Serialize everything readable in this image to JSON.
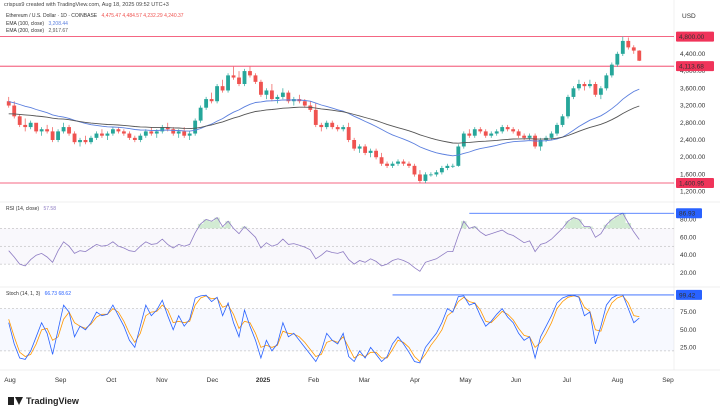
{
  "header": {
    "credit": "crispus9 created with TradingView.com, Aug 18, 2025 09:52 UTC+3"
  },
  "legend": {
    "symbol": "Ethereum / U.S. Dollar · 1D · COINBASE",
    "ohlc": "4,475.47  4,484.57  4,232.29  4,240.37",
    "ema100_label": "EMA (100, close)",
    "ema100_value": "3,208.44",
    "ema200_label": "EMA (200, close)",
    "ema200_value": "2,917.67",
    "rsi_label": "RSI (14, close)",
    "rsi_value": "57.58",
    "stoch_label": "Stoch (14, 1, 3)",
    "stoch_values": "66.73  68.62"
  },
  "colors": {
    "up": "#26a69a",
    "down": "#ef5350",
    "ema100": "#5b7fde",
    "ema200": "#555555",
    "level": "#f0345a",
    "rsi": "#8e7cc3",
    "stoch_k": "#2962ff",
    "stoch_d": "#ff9800",
    "peak_line": "#2962ff"
  },
  "footer": {
    "brand": "TradingView"
  },
  "chart_data": [
    {
      "type": "candlestick",
      "currency_label": "USD",
      "y_ticks": [
        1200,
        1600,
        2000,
        2400,
        2800,
        3200,
        3600,
        4000,
        4400
      ],
      "ylim": [
        1100,
        5000
      ],
      "x_ticks": [
        "Aug",
        "Sep",
        "Oct",
        "Nov",
        "Dec",
        "2025",
        "Feb",
        "Mar",
        "Apr",
        "May",
        "Jun",
        "Jul",
        "Aug",
        "Sep"
      ],
      "levels": [
        {
          "value": 4800,
          "label": "4,800.00"
        },
        {
          "value": 4113.68,
          "label": "4,113.68"
        },
        {
          "value": 1400.95,
          "label": "1,400.95"
        }
      ],
      "ohlc": [
        [
          3300,
          3400,
          3150,
          3200
        ],
        [
          3200,
          3300,
          2900,
          2950
        ],
        [
          2950,
          3000,
          2700,
          2750
        ],
        [
          2750,
          2900,
          2600,
          2700
        ],
        [
          2700,
          2850,
          2650,
          2800
        ],
        [
          2800,
          2750,
          2550,
          2600
        ],
        [
          2600,
          2700,
          2500,
          2650
        ],
        [
          2650,
          2750,
          2550,
          2600
        ],
        [
          2600,
          2700,
          2350,
          2400
        ],
        [
          2400,
          2650,
          2350,
          2600
        ],
        [
          2600,
          2800,
          2550,
          2700
        ],
        [
          2700,
          2750,
          2500,
          2550
        ],
        [
          2550,
          2600,
          2300,
          2350
        ],
        [
          2350,
          2450,
          2250,
          2400
        ],
        [
          2400,
          2500,
          2300,
          2350
        ],
        [
          2350,
          2500,
          2300,
          2450
        ],
        [
          2450,
          2600,
          2400,
          2550
        ],
        [
          2550,
          2650,
          2450,
          2500
        ],
        [
          2500,
          2600,
          2400,
          2550
        ],
        [
          2550,
          2700,
          2500,
          2650
        ],
        [
          2650,
          2700,
          2550,
          2600
        ],
        [
          2600,
          2650,
          2500,
          2550
        ],
        [
          2550,
          2600,
          2400,
          2450
        ],
        [
          2450,
          2500,
          2350,
          2400
        ],
        [
          2400,
          2550,
          2350,
          2500
        ],
        [
          2500,
          2650,
          2450,
          2600
        ],
        [
          2600,
          2700,
          2500,
          2550
        ],
        [
          2550,
          2650,
          2450,
          2600
        ],
        [
          2600,
          2750,
          2550,
          2700
        ],
        [
          2700,
          2800,
          2600,
          2650
        ],
        [
          2650,
          2700,
          2500,
          2550
        ],
        [
          2550,
          2650,
          2450,
          2600
        ],
        [
          2600,
          2700,
          2450,
          2500
        ],
        [
          2500,
          2600,
          2400,
          2550
        ],
        [
          2550,
          2900,
          2500,
          2850
        ],
        [
          2850,
          3200,
          2800,
          3150
        ],
        [
          3150,
          3400,
          3100,
          3350
        ],
        [
          3350,
          3500,
          3250,
          3300
        ],
        [
          3300,
          3700,
          3250,
          3650
        ],
        [
          3650,
          3800,
          3500,
          3550
        ],
        [
          3550,
          3950,
          3500,
          3900
        ],
        [
          3900,
          4100,
          3800,
          3850
        ],
        [
          3850,
          4000,
          3650,
          3700
        ],
        [
          3700,
          4050,
          3650,
          4000
        ],
        [
          4000,
          4100,
          3850,
          3900
        ],
        [
          3900,
          3950,
          3700,
          3750
        ],
        [
          3750,
          3800,
          3400,
          3450
        ],
        [
          3450,
          3600,
          3350,
          3550
        ],
        [
          3550,
          3700,
          3300,
          3350
        ],
        [
          3350,
          3450,
          3250,
          3400
        ],
        [
          3400,
          3600,
          3350,
          3500
        ],
        [
          3500,
          3550,
          3250,
          3300
        ],
        [
          3300,
          3400,
          3200,
          3350
        ],
        [
          3350,
          3450,
          3250,
          3300
        ],
        [
          3300,
          3350,
          3150,
          3200
        ],
        [
          3200,
          3300,
          3050,
          3100
        ],
        [
          3100,
          3250,
          2700,
          2750
        ],
        [
          2750,
          2800,
          2600,
          2700
        ],
        [
          2700,
          2850,
          2650,
          2800
        ],
        [
          2800,
          2850,
          2650,
          2700
        ],
        [
          2700,
          2750,
          2600,
          2650
        ],
        [
          2650,
          2750,
          2600,
          2700
        ],
        [
          2700,
          2800,
          2350,
          2400
        ],
        [
          2400,
          2450,
          2150,
          2200
        ],
        [
          2200,
          2300,
          2100,
          2250
        ],
        [
          2250,
          2300,
          2050,
          2100
        ],
        [
          2100,
          2200,
          2000,
          2150
        ],
        [
          2150,
          2200,
          1950,
          2000
        ],
        [
          2000,
          2100,
          1800,
          1850
        ],
        [
          1850,
          1900,
          1750,
          1800
        ],
        [
          1800,
          1900,
          1750,
          1850
        ],
        [
          1850,
          1950,
          1800,
          1900
        ],
        [
          1900,
          1950,
          1800,
          1850
        ],
        [
          1850,
          1900,
          1750,
          1800
        ],
        [
          1800,
          1850,
          1550,
          1600
        ],
        [
          1600,
          1700,
          1400,
          1450
        ],
        [
          1450,
          1650,
          1400,
          1600
        ],
        [
          1600,
          1650,
          1550,
          1600
        ],
        [
          1600,
          1700,
          1550,
          1650
        ],
        [
          1650,
          1800,
          1600,
          1750
        ],
        [
          1750,
          1850,
          1700,
          1800
        ],
        [
          1800,
          1850,
          1750,
          1800
        ],
        [
          1800,
          2300,
          1780,
          2250
        ],
        [
          2250,
          2600,
          2200,
          2550
        ],
        [
          2550,
          2650,
          2450,
          2500
        ],
        [
          2500,
          2700,
          2450,
          2650
        ],
        [
          2650,
          2700,
          2550,
          2600
        ],
        [
          2600,
          2650,
          2450,
          2500
        ],
        [
          2500,
          2600,
          2450,
          2550
        ],
        [
          2550,
          2650,
          2500,
          2600
        ],
        [
          2600,
          2750,
          2550,
          2700
        ],
        [
          2700,
          2750,
          2600,
          2650
        ],
        [
          2650,
          2700,
          2550,
          2600
        ],
        [
          2600,
          2650,
          2450,
          2500
        ],
        [
          2500,
          2550,
          2400,
          2450
        ],
        [
          2450,
          2550,
          2400,
          2500
        ],
        [
          2500,
          2550,
          2200,
          2250
        ],
        [
          2250,
          2450,
          2150,
          2400
        ],
        [
          2400,
          2500,
          2350,
          2450
        ],
        [
          2450,
          2600,
          2400,
          2550
        ],
        [
          2550,
          2800,
          2500,
          2750
        ],
        [
          2750,
          3000,
          2700,
          2950
        ],
        [
          2950,
          3450,
          2900,
          3400
        ],
        [
          3400,
          3650,
          3350,
          3600
        ],
        [
          3600,
          3800,
          3550,
          3700
        ],
        [
          3700,
          3750,
          3550,
          3650
        ],
        [
          3650,
          3800,
          3600,
          3700
        ],
        [
          3700,
          3750,
          3400,
          3450
        ],
        [
          3450,
          3650,
          3350,
          3600
        ],
        [
          3600,
          3950,
          3550,
          3900
        ],
        [
          3900,
          4200,
          3850,
          4150
        ],
        [
          4150,
          4450,
          4100,
          4400
        ],
        [
          4400,
          4800,
          4350,
          4700
        ],
        [
          4700,
          4780,
          4500,
          4550
        ],
        [
          4550,
          4600,
          4400,
          4475
        ],
        [
          4475,
          4484.57,
          4232.29,
          4240.37
        ]
      ]
    },
    {
      "type": "line",
      "name": "RSI (14, close)",
      "y_ticks": [
        20,
        40,
        60,
        80
      ],
      "ylim": [
        10,
        95
      ],
      "peak_level": {
        "value": 86.93,
        "label": "86.93"
      },
      "values": [
        45,
        38,
        30,
        28,
        35,
        40,
        42,
        38,
        32,
        45,
        55,
        50,
        42,
        45,
        44,
        48,
        52,
        50,
        51,
        55,
        50,
        48,
        45,
        44,
        50,
        55,
        52,
        53,
        58,
        52,
        48,
        52,
        50,
        52,
        65,
        75,
        80,
        78,
        82,
        72,
        78,
        70,
        64,
        72,
        66,
        60,
        48,
        54,
        50,
        52,
        58,
        52,
        53,
        51,
        49,
        46,
        36,
        40,
        45,
        43,
        42,
        44,
        35,
        30,
        34,
        32,
        36,
        33,
        28,
        30,
        34,
        36,
        34,
        31,
        26,
        22,
        32,
        34,
        36,
        40,
        44,
        44,
        62,
        78,
        70,
        72,
        66,
        62,
        64,
        66,
        68,
        64,
        62,
        58,
        54,
        56,
        44,
        52,
        54,
        58,
        64,
        70,
        78,
        82,
        80,
        72,
        72,
        60,
        64,
        74,
        80,
        84,
        86.93,
        76,
        66,
        57.58
      ]
    },
    {
      "type": "line",
      "name": "Stoch (14, 1, 3)",
      "y_ticks": [
        25.0,
        50.0,
        75.0
      ],
      "ylim": [
        0,
        105
      ],
      "peak_level": {
        "value": 99.42,
        "label": "99.42"
      },
      "k": [
        60,
        30,
        10,
        8,
        20,
        40,
        60,
        45,
        15,
        50,
        85,
        75,
        40,
        55,
        50,
        60,
        75,
        70,
        72,
        85,
        70,
        55,
        35,
        25,
        55,
        85,
        70,
        78,
        92,
        70,
        50,
        70,
        55,
        65,
        95,
        98,
        99,
        90,
        96,
        70,
        88,
        60,
        40,
        78,
        55,
        35,
        10,
        35,
        20,
        30,
        60,
        40,
        45,
        35,
        25,
        15,
        5,
        20,
        45,
        35,
        30,
        45,
        12,
        5,
        20,
        10,
        25,
        15,
        5,
        12,
        30,
        40,
        30,
        18,
        5,
        3,
        25,
        35,
        45,
        60,
        80,
        75,
        97,
        98,
        85,
        88,
        70,
        55,
        62,
        72,
        80,
        68,
        60,
        45,
        35,
        40,
        10,
        40,
        55,
        70,
        88,
        95,
        98,
        99,
        96,
        70,
        75,
        30,
        55,
        85,
        95,
        99,
        99.42,
        80,
        60,
        66.73
      ],
      "d": [
        65,
        40,
        18,
        12,
        15,
        30,
        50,
        52,
        35,
        40,
        65,
        75,
        60,
        55,
        52,
        58,
        68,
        72,
        72,
        80,
        75,
        62,
        45,
        32,
        45,
        70,
        75,
        76,
        85,
        78,
        60,
        62,
        60,
        62,
        85,
        95,
        98,
        94,
        95,
        82,
        85,
        72,
        52,
        62,
        60,
        45,
        25,
        28,
        25,
        28,
        48,
        45,
        44,
        40,
        32,
        22,
        12,
        15,
        32,
        35,
        32,
        40,
        25,
        10,
        15,
        12,
        18,
        18,
        10,
        10,
        22,
        35,
        32,
        25,
        12,
        5,
        15,
        28,
        38,
        50,
        70,
        76,
        90,
        96,
        90,
        88,
        78,
        62,
        60,
        68,
        76,
        72,
        64,
        52,
        42,
        40,
        25,
        32,
        45,
        60,
        80,
        90,
        96,
        98,
        97,
        82,
        76,
        50,
        48,
        72,
        88,
        95,
        98,
        88,
        70,
        68.62
      ]
    }
  ]
}
